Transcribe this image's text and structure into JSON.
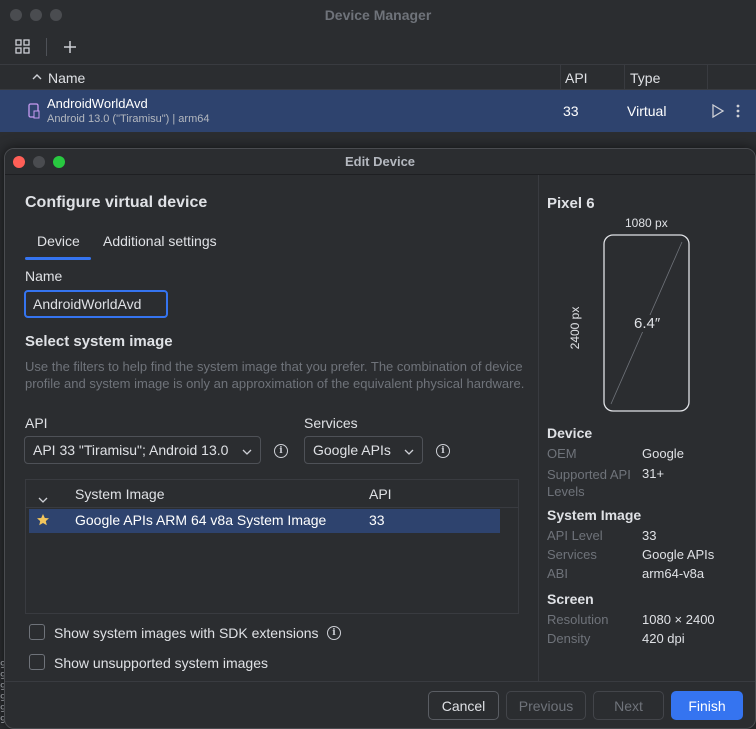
{
  "device_manager": {
    "title": "Device Manager",
    "columns": {
      "name": "Name",
      "api": "API",
      "type": "Type"
    },
    "row": {
      "name": "AndroidWorldAvd",
      "subtitle": "Android 13.0 (\"Tiramisu\") | arm64",
      "api": "33",
      "type": "Virtual"
    }
  },
  "dialog": {
    "title": "Edit Device",
    "heading": "Configure virtual device",
    "tabs": [
      "Device",
      "Additional settings"
    ],
    "name_label": "Name",
    "name_value": "AndroidWorldAvd",
    "system_image_heading": "Select system image",
    "help_text": "Use the filters to help find the system image that you prefer. The combination of device profile and system image is only an approximation of the equivalent physical hardware.",
    "api_label": "API",
    "api_value": "API 33 \"Tiramisu\"; Android 13.0",
    "services_label": "Services",
    "services_value": "Google APIs",
    "table": {
      "col_image": "System Image",
      "col_api": "API",
      "rows": [
        {
          "image": "Google APIs ARM 64 v8a System Image",
          "api": "33"
        }
      ]
    },
    "checkbox_sdk": "Show system images with SDK extensions",
    "checkbox_unsupported": "Show unsupported system images",
    "buttons": {
      "cancel": "Cancel",
      "previous": "Previous",
      "next": "Next",
      "finish": "Finish"
    }
  },
  "preview": {
    "device_name": "Pixel 6",
    "width_label": "1080 px",
    "height_label": "2400 px",
    "diagonal": "6.4″",
    "device_section": "Device",
    "oem_key": "OEM",
    "oem_val": "Google",
    "min_api_key": "Supported API Levels",
    "min_api_val": "31+",
    "system_image_section": "System Image",
    "api_level_key": "API Level",
    "api_level_val": "33",
    "services_key": "Services",
    "services_val": "Google APIs",
    "abi_key": "ABI",
    "abi_val": "arm64-v8a",
    "screen_section": "Screen",
    "resolution_key": "Resolution",
    "resolution_val": "1080 × 2400",
    "density_key": "Density",
    "density_val": "420 dpi"
  },
  "colors": {
    "accent": "#3574f0",
    "selection": "#2e436e",
    "close": "#ff5f57",
    "minimize": "#febc2e",
    "maximize": "#28c840"
  }
}
